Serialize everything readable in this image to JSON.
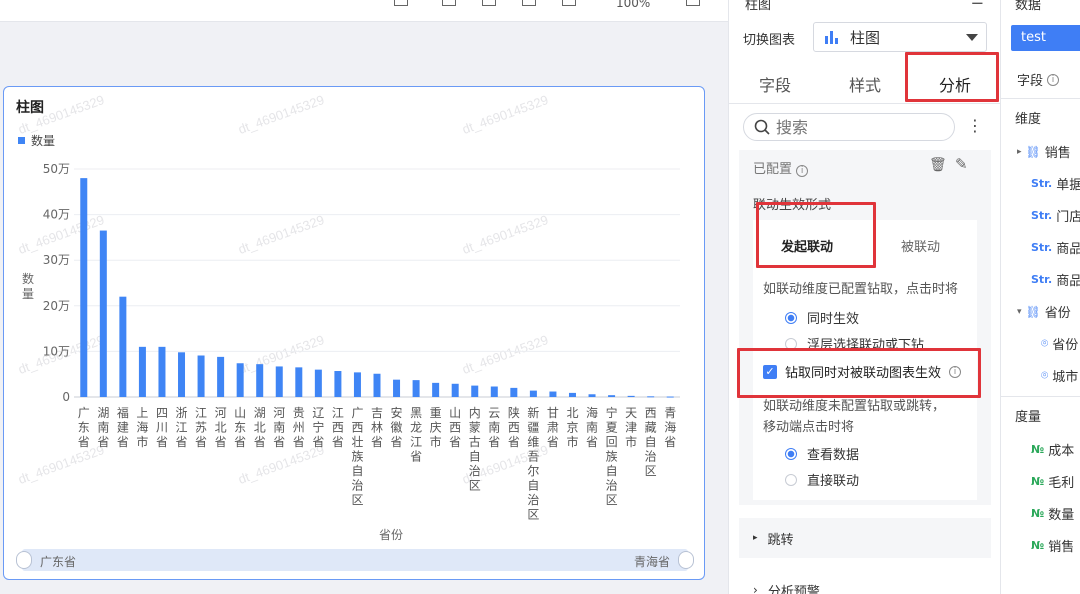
{
  "toolbar": {
    "zoom": "100%"
  },
  "chart": {
    "title": "柱图",
    "legend": "数量",
    "watermark": "dt_4690145329",
    "slider_start": "广东省",
    "slider_end": "青海省"
  },
  "chart_data": {
    "type": "bar",
    "title": "柱图",
    "xlabel": "省份",
    "ylabel": "数量",
    "ylim": [
      0,
      500000
    ],
    "yticks": [
      "0",
      "10万",
      "20万",
      "30万",
      "40万",
      "50万"
    ],
    "legend": [
      "数量"
    ],
    "legend_position": "top-left",
    "grid": true,
    "categories": [
      "广东省",
      "湖南省",
      "福建省",
      "上海市",
      "四川省",
      "浙江省",
      "江苏省",
      "河北省",
      "山东省",
      "湖北省",
      "河南省",
      "贵州省",
      "辽宁省",
      "江西省",
      "广西壮族自治区",
      "吉林省",
      "安徽省",
      "黑龙江省",
      "重庆市",
      "山西省",
      "内蒙古自治区",
      "云南省",
      "陕西省",
      "新疆维吾尔自治区",
      "甘肃省",
      "北京市",
      "海南省",
      "宁夏回族自治区",
      "天津市",
      "西藏自治区",
      "青海省"
    ],
    "series": [
      {
        "name": "数量",
        "color": "#3f85f5",
        "values": [
          480000,
          365000,
          220000,
          110000,
          110000,
          98000,
          91000,
          88000,
          74000,
          72000,
          67000,
          65000,
          60000,
          57000,
          54000,
          51000,
          38000,
          37000,
          31000,
          29000,
          25000,
          23000,
          20000,
          14000,
          12000,
          9000,
          6000,
          4000,
          2500,
          1500,
          1000
        ]
      }
    ]
  },
  "config_panel": {
    "panel_title": "柱图",
    "switch_label": "切换图表",
    "chart_type": "柱图",
    "tabs": [
      "字段",
      "样式",
      "分析"
    ],
    "search_placeholder": "搜索",
    "configured": "已配置",
    "linkage_title": "联动生效形式",
    "subtab_initiate": "发起联动",
    "subtab_passive": "被联动",
    "hint1": "如联动维度已配置钻取，点击时将",
    "radio1": "同时生效",
    "radio2": "浮层选择联动或下钻",
    "checkbox_label": "钻取同时对被联动图表生效",
    "hint2a": "如联动维度未配置钻取或跳转，",
    "hint2b": "移动端点击时将",
    "radio3": "查看数据",
    "radio4": "直接联动",
    "jump": "跳转",
    "analysis_warning": "分析预警"
  },
  "data_panel": {
    "title": "数据",
    "dataset": "test",
    "fields_label": "字段",
    "dimension_label": "维度",
    "dimensions": [
      "销售",
      "单据",
      "门店",
      "商品",
      "商品",
      "省份",
      "省份",
      "城市"
    ],
    "measure_label": "度量",
    "measures": [
      "成本",
      "毛利",
      "数量",
      "销售"
    ]
  },
  "colors": {
    "accent": "#3f7ef5",
    "highlight": "#e0343a",
    "bar": "#3f85f5"
  }
}
